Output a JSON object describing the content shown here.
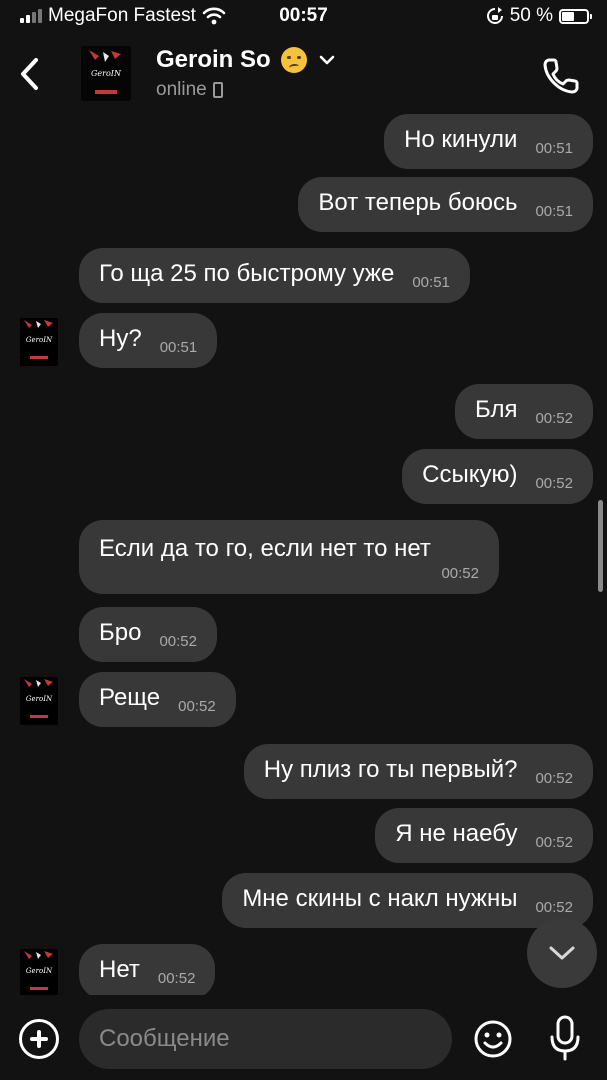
{
  "status_bar": {
    "carrier": "MegaFon Fastest",
    "time": "00:57",
    "battery_percent": "50 %",
    "battery_level": 0.5
  },
  "header": {
    "contact_name": "Geroin So",
    "status": "online",
    "avatar_text": "GeroIN"
  },
  "messages": [
    {
      "side": "out",
      "text": "Но кинули",
      "time": "00:51"
    },
    {
      "side": "out",
      "text": "Вот теперь боюсь",
      "time": "00:51"
    },
    {
      "side": "in",
      "text": "Го ща 25 по быстрому уже",
      "time": "00:51"
    },
    {
      "side": "in",
      "text": "Ну?",
      "time": "00:51"
    },
    {
      "side": "out",
      "text": "Бля",
      "time": "00:52"
    },
    {
      "side": "out",
      "text": "Ссыкую)",
      "time": "00:52"
    },
    {
      "side": "in",
      "text": "Если да то го, если нет то нет",
      "time": "00:52"
    },
    {
      "side": "in",
      "text": "Бро",
      "time": "00:52"
    },
    {
      "side": "in",
      "text": "Реще",
      "time": "00:52"
    },
    {
      "side": "out",
      "text": "Ну плиз го ты первый?",
      "time": "00:52"
    },
    {
      "side": "out",
      "text": "Я не наебу",
      "time": "00:52"
    },
    {
      "side": "out",
      "text": "Мне скины с накл нужны",
      "time": "00:52"
    },
    {
      "side": "in",
      "text": "Нет",
      "time": "00:52"
    }
  ],
  "input": {
    "placeholder": "Сообщение"
  },
  "icons": {
    "back": "chevron-left-icon",
    "call": "phone-icon",
    "add": "plus-circle-icon",
    "emoji": "smiley-icon",
    "mic": "microphone-icon",
    "scroll": "chevron-down-icon"
  }
}
